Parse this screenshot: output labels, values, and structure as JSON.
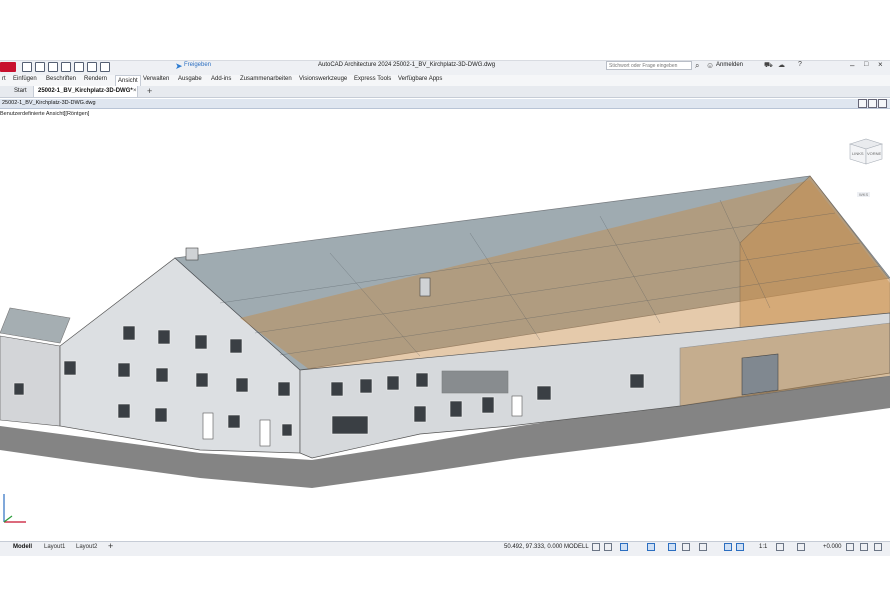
{
  "app": {
    "title": "AutoCAD Architecture 2024   25002-1_BV_Kirchplatz-3D-DWG.dwg",
    "share_label": "Freigeben",
    "search_placeholder": "Stichwort oder Frage eingeben",
    "signin_label": "Anmelden",
    "brand_color": "#c8102e",
    "accent_color": "#2b6ec0"
  },
  "ribbon": {
    "tabs": [
      {
        "label": "rt"
      },
      {
        "label": "Einfügen"
      },
      {
        "label": "Beschriften"
      },
      {
        "label": "Rendern"
      },
      {
        "label": "Ansicht",
        "active": true
      },
      {
        "label": "Verwalten"
      },
      {
        "label": "Ausgabe"
      },
      {
        "label": "Add-ins"
      },
      {
        "label": "Zusammenarbeiten"
      },
      {
        "label": "Visionswerkzeuge"
      },
      {
        "label": "Express Tools"
      },
      {
        "label": "Verfügbare Apps"
      }
    ]
  },
  "doc_tabs": {
    "start": "Start",
    "file": "25002-1_BV_Kirchplatz-3D-DWG*",
    "close": "×",
    "add": "+"
  },
  "drawing": {
    "name": "25002-1_BV_Kirchplatz-3D-DWG.dwg",
    "view_label": "Benutzerdefinierte Ansicht][Röntgen]"
  },
  "viewcube": {
    "face_left": "LINKS",
    "face_front": "VORNE",
    "wcs_label": "WKS"
  },
  "statusbar": {
    "layout_tabs": [
      {
        "label": "Modell",
        "active": true
      },
      {
        "label": "Layout1"
      },
      {
        "label": "Layout2"
      }
    ],
    "add_layout": "+",
    "coordinates": "50.492, 97.333, 0.000",
    "mode": "MODELL",
    "scale": "1:1",
    "elevation": "+0.000"
  },
  "icons": [
    "app-logo-icon",
    "new-icon",
    "open-icon",
    "save-icon",
    "saveas-icon",
    "plot-icon",
    "undo-icon",
    "redo-icon",
    "share-icon",
    "search-icon",
    "user-icon",
    "cart-icon",
    "cloud-icon",
    "help-icon",
    "viewcube-icon",
    "ucs-icon",
    "grid-icon",
    "snap-icon",
    "ortho-icon",
    "polar-icon",
    "settings-icon"
  ]
}
